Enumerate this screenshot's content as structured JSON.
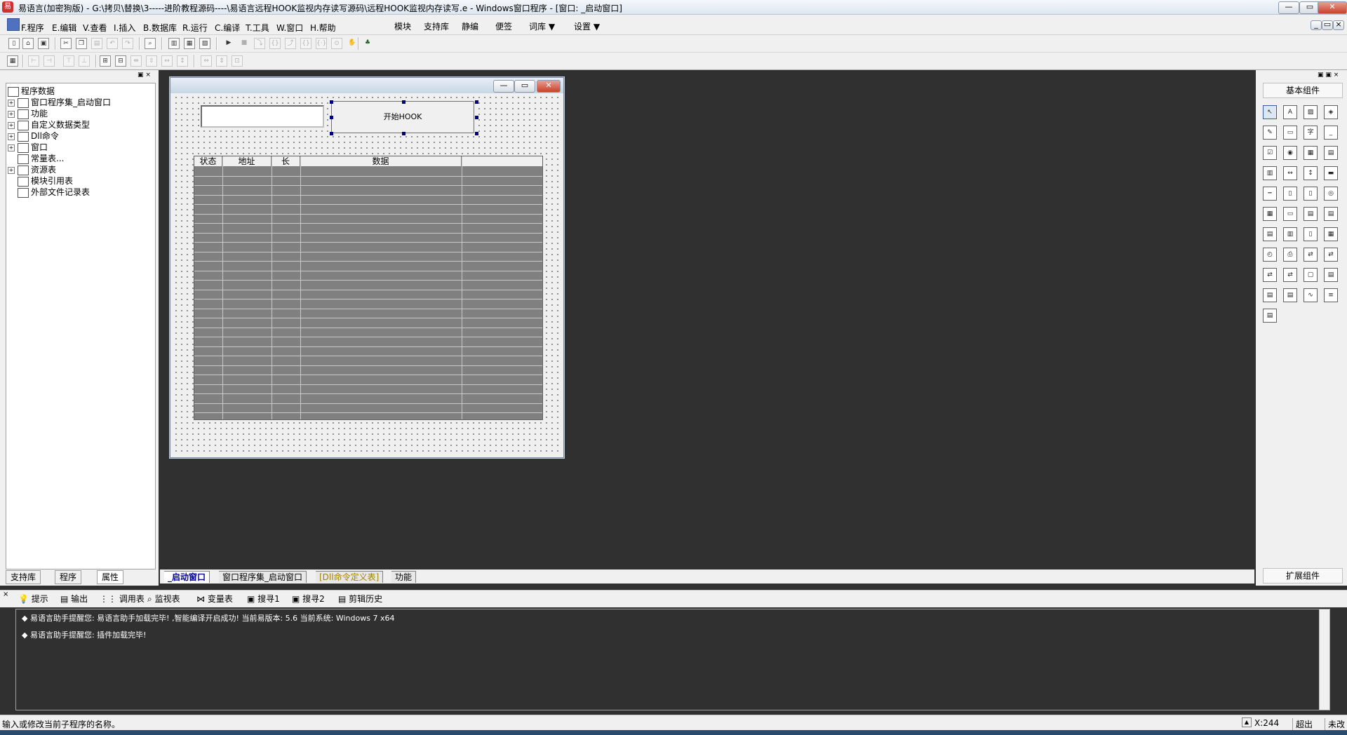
{
  "window": {
    "title": "易语言(加密狗版) - G:\\拷贝\\替换\\3-----进阶教程源码----\\易语言远程HOOK监视内存读写源码\\远程HOOK监视内存读写.e - Windows窗口程序 - [窗口: _启动窗口]",
    "app_icon": "易",
    "min": "—",
    "max": "▭",
    "close": "✕"
  },
  "menu": {
    "items": [
      {
        "key": "F",
        "label": "F.程序"
      },
      {
        "key": "E",
        "label": "E.编辑"
      },
      {
        "key": "V",
        "label": "V.查看"
      },
      {
        "key": "I",
        "label": "I.插入"
      },
      {
        "key": "B",
        "label": "B.数据库"
      },
      {
        "key": "R",
        "label": "R.运行"
      },
      {
        "key": "C",
        "label": "C.编译"
      },
      {
        "key": "T",
        "label": "T.工具"
      },
      {
        "key": "W",
        "label": "W.窗口"
      },
      {
        "key": "H",
        "label": "H.帮助"
      }
    ],
    "right_items": [
      "模块",
      "支持库",
      "静编",
      "便签",
      "词库 ▼",
      "设置 ▼"
    ]
  },
  "tree": {
    "root": "程序数据",
    "items": [
      {
        "label": "窗口程序集_启动窗口",
        "exp": "+"
      },
      {
        "label": "功能",
        "exp": "+"
      },
      {
        "label": "自定义数据类型",
        "exp": "+"
      },
      {
        "label": "Dll命令",
        "exp": "+"
      },
      {
        "label": "窗口",
        "exp": "+"
      },
      {
        "label": "常量表...",
        "exp": ""
      },
      {
        "label": "资源表",
        "exp": "+"
      },
      {
        "label": "模块引用表",
        "exp": ""
      },
      {
        "label": "外部文件记录表",
        "exp": ""
      }
    ]
  },
  "left_tabs": [
    "支持库",
    "程序",
    "属性"
  ],
  "designer": {
    "button_label": "开始HOOK",
    "grid_headers": [
      "状态",
      "地址",
      "长",
      "数据",
      ""
    ]
  },
  "doc_tabs": [
    "_启动窗口",
    "窗口程序集_启动窗口",
    "[Dll命令定义表]",
    "功能"
  ],
  "toolbox": {
    "header": "基本组件",
    "footer": "扩展组件"
  },
  "output_tabs": [
    "提示",
    "输出",
    "调用表",
    "监视表",
    "变量表",
    "搜寻1",
    "搜寻2",
    "剪辑历史"
  ],
  "output_lines": [
    "◆ 易语言助手提醒您: 易语言助手加载完毕!  ,智能编译开启成功!  当前易版本: 5.6  当前系统: Windows 7 x64",
    "◆ 易语言助手提醒您: 插件加载完毕!"
  ],
  "status": {
    "hint": "输入或修改当前子程序的名称。",
    "coord": "X:244",
    "mode": "超出",
    "save": "未改"
  },
  "colors": {
    "workspace": "#303030",
    "selection_handle": "#000080"
  }
}
